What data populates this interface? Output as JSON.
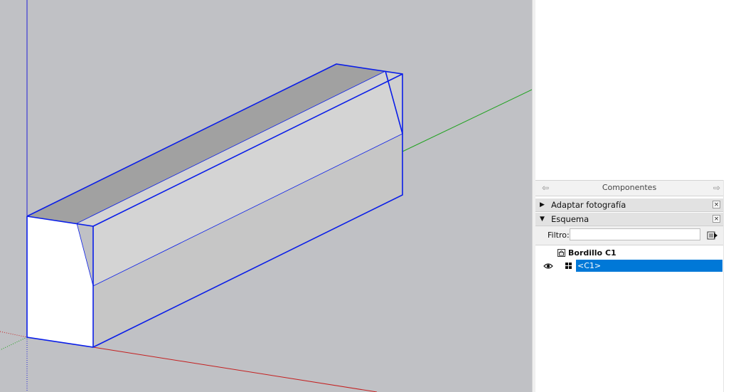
{
  "colors": {
    "viewport_bg": "#c0c1c5",
    "edge_blue": "#0a1ee8",
    "axis_red": "#c42020",
    "axis_green": "#1fa21f",
    "axis_blue": "#2020d8",
    "selection_blue": "#0078d7",
    "face_white": "#ffffff",
    "face_top": "#a1a1a1",
    "face_light": "#d4d4d4",
    "face_mid": "#c6c6c6"
  },
  "viewport": {
    "content": "3D model of a curb block (selected, blue edges) on red/green/blue axes"
  },
  "tray": {
    "title": "Componentes",
    "nav_back_icon": "arrow-left-icon",
    "nav_forward_icon": "arrow-right-icon",
    "panels": [
      {
        "label": "Adaptar fotografía",
        "state": "collapsed",
        "close": "×"
      },
      {
        "label": "Esquema",
        "state": "expanded",
        "close": "×"
      }
    ],
    "filter": {
      "label": "Filtro:",
      "value": "",
      "placeholder": ""
    },
    "outliner": {
      "model_name": "Bordillo C1",
      "items": [
        {
          "label": "<C1>",
          "selected": true,
          "visible": true,
          "icon": "component-icon"
        }
      ]
    }
  }
}
